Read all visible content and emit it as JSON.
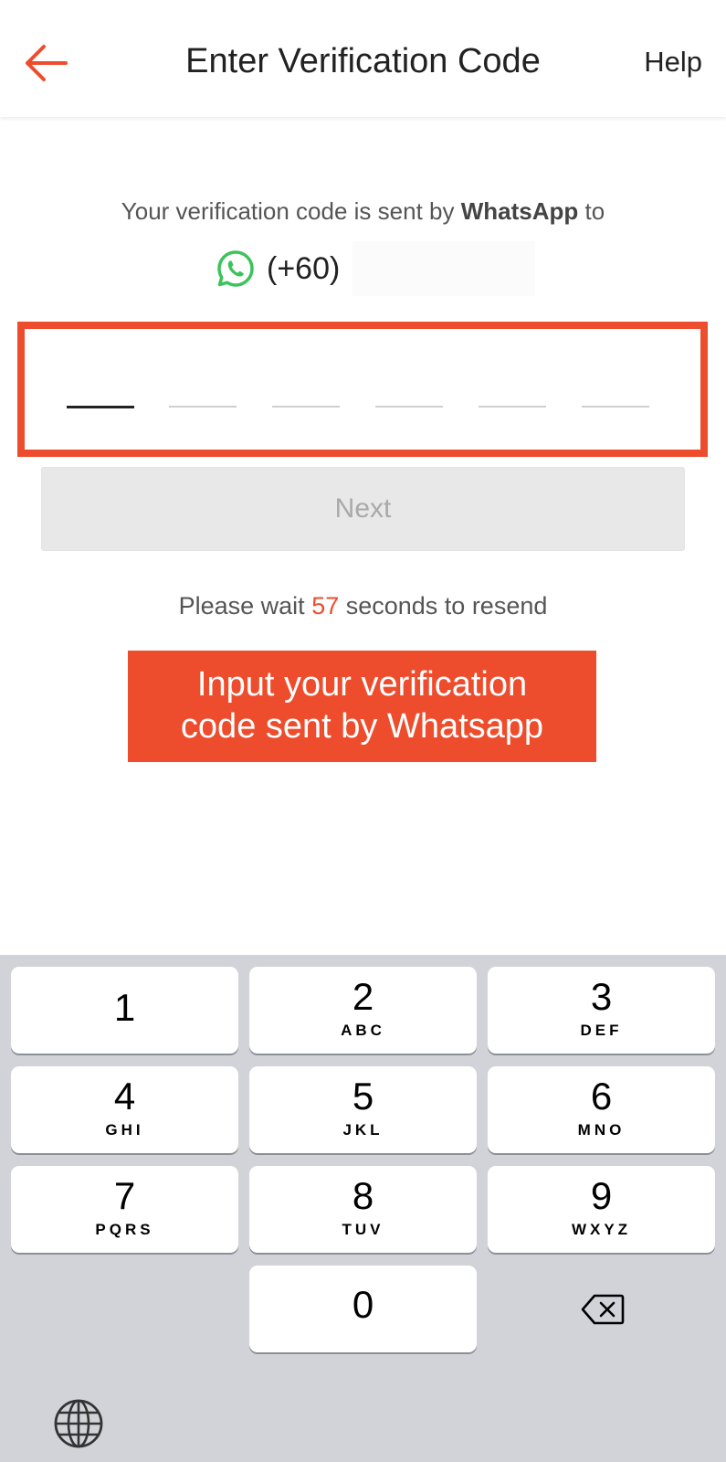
{
  "header": {
    "back_icon": "arrow-left-icon",
    "title": "Enter Verification Code",
    "help_label": "Help",
    "accent_color": "#ee4d2d"
  },
  "info": {
    "prefix": "Your verification code is sent by ",
    "channel": "WhatsApp",
    "suffix": " to",
    "channel_icon": "whatsapp-icon",
    "phone_code": "(+60)"
  },
  "code_input": {
    "slots": 6,
    "active_slot": 1,
    "value": ""
  },
  "next_button": {
    "label": "Next",
    "enabled": false
  },
  "resend": {
    "prefix": "Please wait ",
    "seconds": "57",
    "suffix": " seconds to resend"
  },
  "callout": {
    "line1": "Input your verification",
    "line2": "code sent by Whatsapp"
  },
  "keyboard": {
    "keys": [
      {
        "digit": "1",
        "letters": ""
      },
      {
        "digit": "2",
        "letters": "ABC"
      },
      {
        "digit": "3",
        "letters": "DEF"
      },
      {
        "digit": "4",
        "letters": "GHI"
      },
      {
        "digit": "5",
        "letters": "JKL"
      },
      {
        "digit": "6",
        "letters": "MNO"
      },
      {
        "digit": "7",
        "letters": "PQRS"
      },
      {
        "digit": "8",
        "letters": "TUV"
      },
      {
        "digit": "9",
        "letters": "WXYZ"
      },
      {
        "digit": "0",
        "letters": ""
      }
    ],
    "delete_icon": "backspace-icon",
    "globe_icon": "globe-icon"
  }
}
